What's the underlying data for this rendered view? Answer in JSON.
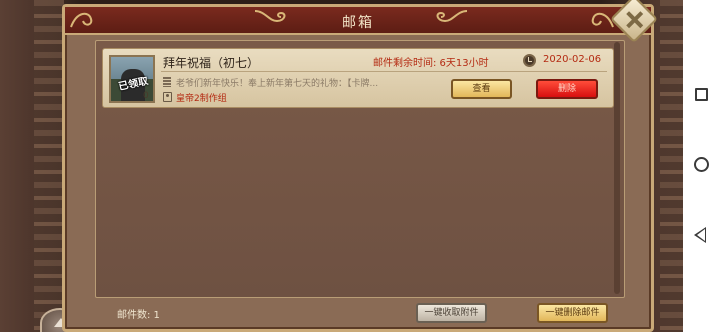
{
  "window": {
    "title": "邮箱"
  },
  "mail": {
    "items": [
      {
        "avatar_stamp": "已领取",
        "avatar_count": "0",
        "title": "拜年祝福（初七）",
        "expire_label": "邮件剩余时间: 6天13小时",
        "date": "2020-02-06",
        "snippet": "老爷们新年快乐！奉上新年第七天的礼物：【卡牌...",
        "sender": "皇帝2制作组",
        "view_label": "查看",
        "delete_label": "删除"
      }
    ]
  },
  "footer": {
    "count_label": "邮件数:  1",
    "collect_all_label": "一键收取附件",
    "delete_all_label": "一键删除邮件"
  },
  "icons": [
    "close-icon",
    "clock-icon",
    "message-icon",
    "sender-icon",
    "home-icon",
    "recents-icon",
    "back-icon"
  ],
  "colors": {
    "title_bar": "#6b2318",
    "accent_red": "#b42a12",
    "delete_button": "#e51e15",
    "gold_button": "#e9c46a"
  }
}
